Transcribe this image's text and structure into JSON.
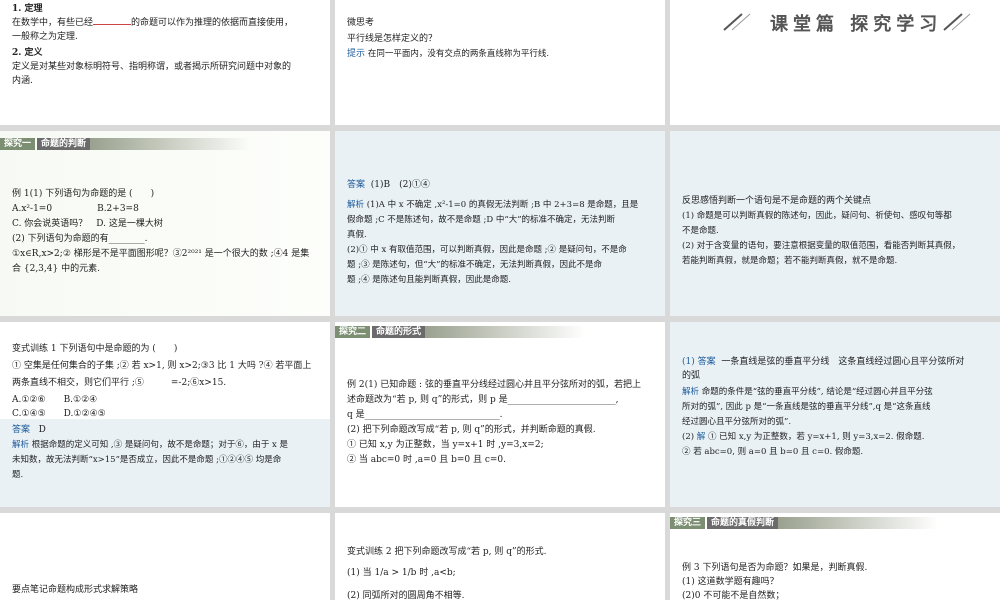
{
  "c1": {
    "h1": "1. 定理",
    "l1a": "在数学中，有些已经",
    "l1b": "的命题可以作为推理的依据而直接使用，",
    "l2": "一般称之为定理.",
    "h2": "2. 定义",
    "l3": "定义是对某些对象标明符号、指明称谓，或者揭示所研究问题中对象的",
    "l4": "内涵."
  },
  "c2": {
    "h": "微思考",
    "q": "平行线是怎样定义的？",
    "hint_label": "提示",
    "hint": "在同一平面内，没有交点的两条直线称为平行线."
  },
  "c3": {
    "title": "课堂篇 探究学习"
  },
  "c4": {
    "tag_a": "探究一",
    "tag_b": "命题的判断",
    "l1": "例 1(1) 下列语句为命题的是 (　　)",
    "l2": "A.x²-1=0　　　　　B.2+3=8",
    "l3": "C. 你会说英语吗？　D. 这是一棵大树",
    "l4": "(2) 下列语句为命题的有________.",
    "l5": "①x∈R,x>2;② 梯形是不是平面图形呢？③2²⁰²¹ 是一个很大的数 ;④4 是集",
    "l6": "合 {2,3,4} 中的元素."
  },
  "c5": {
    "ans_label": "答案",
    "ans": "(1)B　(2)①④",
    "exp_label": "解析",
    "l1": "(1)A 中 x 不确定 ,x²-1=0 的真假无法判断 ;B 中 2+3=8 是命题，且是",
    "l2": "假命题 ;C 不是陈述句，故不是命题 ;D 中“大”的标准不确定，无法判断",
    "l3": "真假.",
    "l4": "(2)① 中 x 有取值范围，可以判断真假，因此是命题 ;② 是疑问句，不是命",
    "l5": "题 ;③ 是陈述句，但“大”的标准不确定，无法判断真假，因此不是命",
    "l6": "题 ;④ 是陈述句且能判断真假，因此是命题."
  },
  "c6": {
    "h": "反思感悟判断一个语句是不是命题的两个关键点",
    "l1": "(1) 命题是可以判断真假的陈述句，因此，疑问句、祈使句、感叹句等都",
    "l2": "不是命题.",
    "l3": "(2) 对于含变量的语句，要注意根据变量的取值范围，看能否判断其真假，",
    "l4": "若能判断真假，就是命题；若不能判断真假，就不是命题."
  },
  "c7": {
    "l1": "变式训练 1 下列语句中是命题的为 (　　)",
    "l2": "① 空集是任何集合的子集 ;② 若 x>1, 则 x>2;③3 比 1 大吗 ?④ 若平面上",
    "l3": "两条直线不相交，则它们平行 ;⑤　　　=-2;⑥x>15.",
    "l4": "A.①②⑥　　B.①②④",
    "l5": "C.①④⑤　　D.①②④⑤",
    "ans_label": "答案",
    "ans": "D",
    "exp_label": "解析",
    "e1": "根据命题的定义可知 ,③ 是疑问句，故不是命题；对于⑥，由于 x 是",
    "e2": "未知数，故无法判断“x>15”是否成立，因此不是命题 ;①②④⑤ 均是命",
    "e3": "题."
  },
  "c8": {
    "tag_a": "探究二",
    "tag_b": "命题的形式",
    "l1": "例 2(1) 已知命题 : 弦的垂直平分线经过圆心并且平分弦所对的弧，若把上",
    "l2": "述命题改为“若 p, 则 q”的形式，则 p 是________________________,",
    "l3": "q 是______________________________.",
    "l4": "(2) 把下列命题改写成“若 p, 则 q”的形式，并判断命题的真假.",
    "l5": "① 已知 x,y 为正整数，当 y=x+1 时 ,y=3,x=2;",
    "l6": "② 当 abc=0 时 ,a=0 且 b=0 且 c=0."
  },
  "c9": {
    "ans_label": "(1) 答案",
    "ans": "一条直线是弦的垂直平分线　这条直线经过圆心且平分弦所对",
    "ans2": "的弧",
    "exp_label": "解析",
    "e1": "命题的条件是“弦的垂直平分线”, 结论是“经过圆心并且平分弦",
    "e2": "所对的弧”, 因此 p 是“一条直线是弦的垂直平分线”,q 是“这条直线",
    "e3": "经过圆心且平分弦所对的弧”.",
    "sol_a": "(2)",
    "sol_label": "解",
    "s1": "① 已知 x,y 为正整数，若 y=x+1, 则 y=3,x=2. 假命题.",
    "s2": "② 若 abc=0, 则 a=0 且 b=0 且 c=0. 假命题."
  },
  "c10": {
    "l1": "要点笔记命题构成形式求解策略"
  },
  "c11": {
    "l1": "变式训练 2 把下列命题改写成“若 p, 则 q”的形式.",
    "l2": "(1) 当 1/a > 1/b 时 ,a<b;",
    "l3": "(2) 同弧所对的圆周角不相等."
  },
  "c12": {
    "tag_a": "探究三",
    "tag_b": "命题的真假判断",
    "l1": "例 3 下列语句是否为命题？如果是，判断真假.",
    "l2": "(1) 这道数学题有趣吗？",
    "l3": "(2)0 不可能不是自然数；"
  }
}
